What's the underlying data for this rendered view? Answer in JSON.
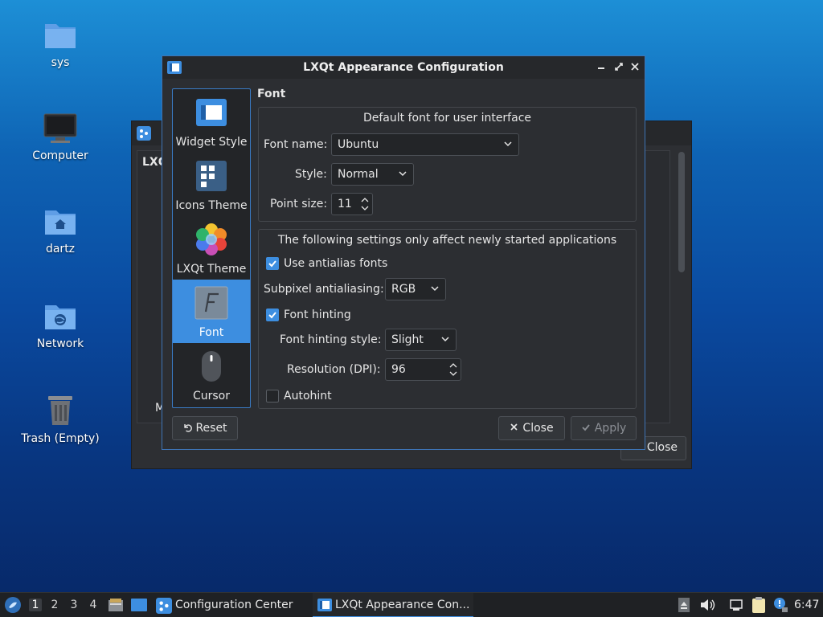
{
  "desktop": {
    "icons": [
      {
        "label": "sys",
        "icon": "folder-icon"
      },
      {
        "label": "Computer",
        "icon": "computer-icon"
      },
      {
        "label": "dartz",
        "icon": "home-folder-icon"
      },
      {
        "label": "Network",
        "icon": "network-folder-icon"
      },
      {
        "label": "Trash (Empty)",
        "icon": "trash-icon"
      }
    ]
  },
  "background_window": {
    "partial_label": "LXQ",
    "partial_letter": "M",
    "close_label": "Close"
  },
  "dialog": {
    "title": "LXQt Appearance Configuration",
    "sidebar": [
      {
        "label": "Widget Style",
        "icon": "widget-style-icon"
      },
      {
        "label": "Icons Theme",
        "icon": "icons-theme-icon"
      },
      {
        "label": "LXQt Theme",
        "icon": "lxqt-theme-icon"
      },
      {
        "label": "Font",
        "icon": "font-icon",
        "selected": true
      },
      {
        "label": "Cursor",
        "icon": "mouse-cursor-icon"
      }
    ],
    "section_title": "Font",
    "default_font_group": {
      "title": "Default font for user interface",
      "font_name_label": "Font name:",
      "font_name_value": "Ubuntu",
      "style_label": "Style:",
      "style_value": "Normal",
      "point_size_label": "Point size:",
      "point_size_value": "11"
    },
    "new_apps_group": {
      "title": "The following settings only affect newly started applications",
      "antialias_label": "Use antialias fonts",
      "antialias_checked": true,
      "subpixel_label": "Subpixel antialiasing:",
      "subpixel_value": "RGB",
      "hinting_label": "Font hinting",
      "hinting_checked": true,
      "hinting_style_label": "Font hinting style:",
      "hinting_style_value": "Slight",
      "resolution_label": "Resolution (DPI):",
      "resolution_value": "96",
      "autohint_label": "Autohint",
      "autohint_checked": false
    },
    "buttons": {
      "reset": "Reset",
      "close": "Close",
      "apply": "Apply"
    }
  },
  "taskbar": {
    "desktops": [
      "1",
      "2",
      "3",
      "4"
    ],
    "current_desktop": "1",
    "tasks": [
      {
        "label": "Configuration Center",
        "active": false
      },
      {
        "label": "LXQt Appearance Con...",
        "active": true
      }
    ],
    "clock": "6:47"
  },
  "colors": {
    "accent": "#3d8ee0",
    "window_bg": "#2c2e32",
    "taskbar_bg": "#1f2124"
  }
}
